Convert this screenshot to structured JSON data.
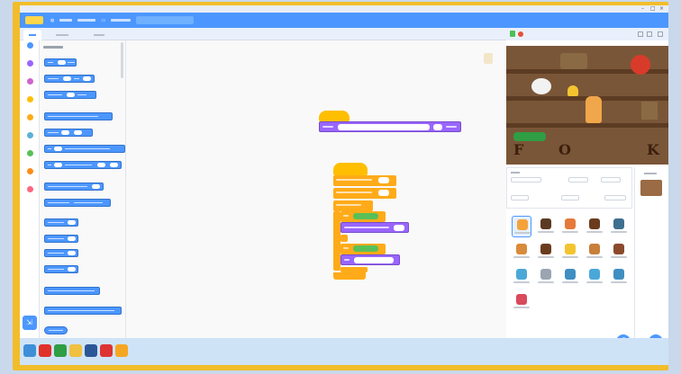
{
  "colors": {
    "frame": "#f2bd2a",
    "menubar": "#4c97ff",
    "motion": "#4c97ff",
    "looks": "#9966ff",
    "sound": "#cf63cf",
    "events": "#ffbf00",
    "control": "#ffab19",
    "sensing": "#5cb1d6",
    "operators": "#59c059",
    "variables": "#ff8c1a",
    "myblocks": "#ff6680"
  },
  "categories": [
    {
      "icon": "motion-icon",
      "color": "#4c97ff"
    },
    {
      "icon": "looks-icon",
      "color": "#9966ff"
    },
    {
      "icon": "sound-icon",
      "color": "#cf63cf"
    },
    {
      "icon": "events-icon",
      "color": "#ffbf00"
    },
    {
      "icon": "control-icon",
      "color": "#ffab19"
    },
    {
      "icon": "sensing-icon",
      "color": "#5cb1d6"
    },
    {
      "icon": "operators-icon",
      "color": "#59c059"
    },
    {
      "icon": "variables-icon",
      "color": "#ff8c1a"
    },
    {
      "icon": "myblocks-icon",
      "color": "#ff6680"
    }
  ],
  "letters": [
    "F",
    "O",
    "K"
  ],
  "sprites": [
    {
      "color": "#f4a23a"
    },
    {
      "color": "#5a3a22"
    },
    {
      "color": "#e57a3a"
    },
    {
      "color": "#6b3b1e"
    },
    {
      "color": "#3d6f8f"
    },
    {
      "color": "#d98a3a"
    },
    {
      "color": "#6b3b1e"
    },
    {
      "color": "#f4c430"
    },
    {
      "color": "#c87f3a"
    },
    {
      "color": "#8b4a2b"
    },
    {
      "color": "#4aa8d8"
    },
    {
      "color": "#9aa5b1"
    },
    {
      "color": "#3f8fc2"
    },
    {
      "color": "#4aa8d8"
    },
    {
      "color": "#3f8fc2"
    },
    {
      "color": "#d94a5a"
    }
  ],
  "taskbar_apps": [
    {
      "icon": "windows-start-icon",
      "color": "#3f8fd8"
    },
    {
      "icon": "opera-icon",
      "color": "#e0312b"
    },
    {
      "icon": "chrome-icon",
      "color": "#2f9e44"
    },
    {
      "icon": "file-explorer-icon",
      "color": "#f0c040"
    },
    {
      "icon": "word-icon",
      "color": "#2b5797"
    },
    {
      "icon": "pdf-icon",
      "color": "#d33"
    },
    {
      "icon": "scratch-icon",
      "color": "#f5a623"
    }
  ]
}
